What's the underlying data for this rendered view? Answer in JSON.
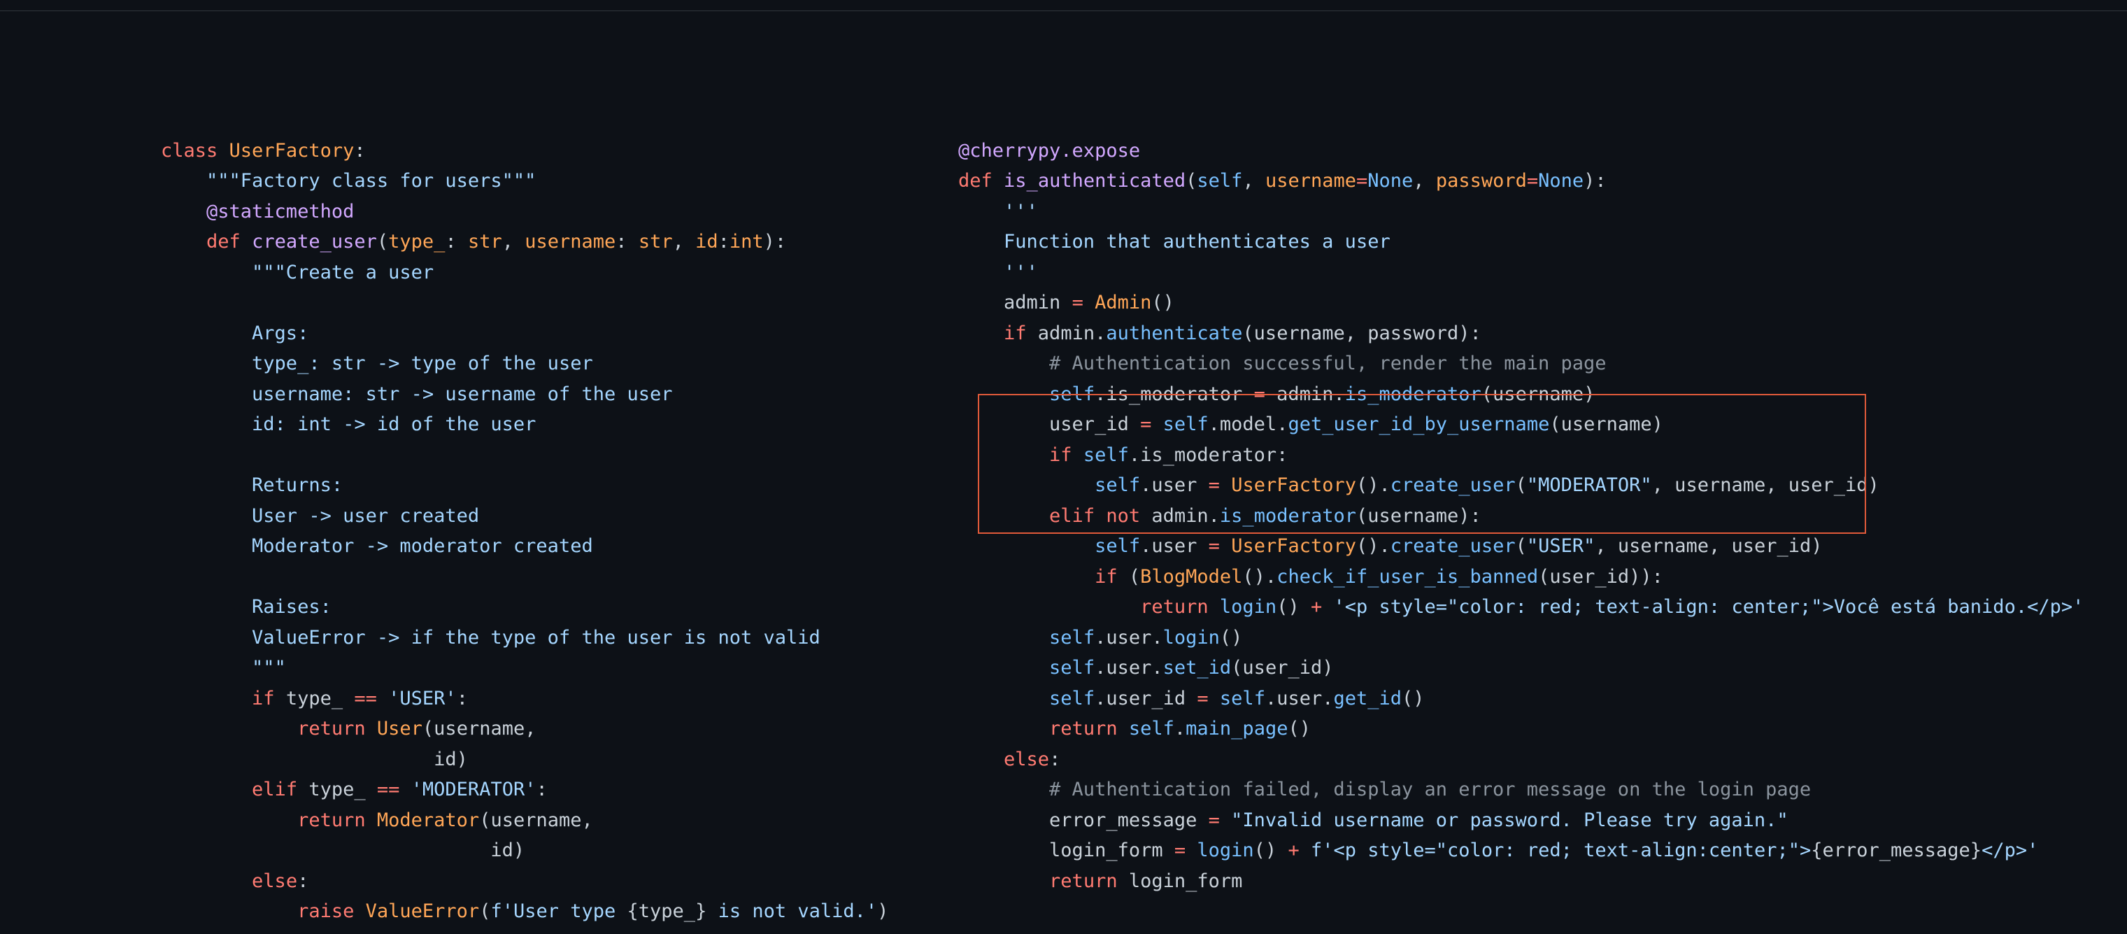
{
  "left": {
    "l01a": "class",
    "l01b": " ",
    "l01c": "UserFactory",
    "l01d": ":",
    "l02": "    \"\"\"Factory class for users\"\"\"",
    "l03": "    @staticmethod",
    "l04a": "    ",
    "l04b": "def",
    "l04c": " ",
    "l04d": "create_user",
    "l04e": "(",
    "l04f": "type_",
    "l04g": ": ",
    "l04h": "str",
    "l04i": ", ",
    "l04j": "username",
    "l04k": ": ",
    "l04l": "str",
    "l04m": ", ",
    "l04n": "id",
    "l04o": ":",
    "l04p": "int",
    "l04q": "):",
    "l05": "        \"\"\"Create a user",
    "l06": "",
    "l07": "        Args:",
    "l08": "        type_: str -> type of the user",
    "l09": "        username: str -> username of the user",
    "l10": "        id: int -> id of the user",
    "l11": "",
    "l12": "        Returns:",
    "l13": "        User -> user created",
    "l14": "        Moderator -> moderator created",
    "l15": "",
    "l16": "        Raises:",
    "l17": "        ValueError -> if the type of the user is not valid",
    "l18": "        \"\"\"",
    "l19a": "        ",
    "l19b": "if",
    "l19c": " type_ ",
    "l19d": "==",
    "l19e": " ",
    "l19f": "'USER'",
    "l19g": ":",
    "l20a": "            ",
    "l20b": "return",
    "l20c": " ",
    "l20d": "User",
    "l20e": "(username,",
    "l21": "                        id)",
    "l22a": "        ",
    "l22b": "elif",
    "l22c": " type_ ",
    "l22d": "==",
    "l22e": " ",
    "l22f": "'MODERATOR'",
    "l22g": ":",
    "l23a": "            ",
    "l23b": "return",
    "l23c": " ",
    "l23d": "Moderator",
    "l23e": "(username,",
    "l24": "                             id)",
    "l25a": "        ",
    "l25b": "else",
    "l25c": ":",
    "l26a": "            ",
    "l26b": "raise",
    "l26c": " ",
    "l26d": "ValueError",
    "l26e": "(",
    "l26f": "f'User type ",
    "l26g": "{type_}",
    "l26h": " is not valid.'",
    "l26i": ")"
  },
  "right": {
    "r01": "@cherrypy.expose",
    "r02a": "def",
    "r02b": " ",
    "r02c": "is_authenticated",
    "r02d": "(",
    "r02e": "self",
    "r02f": ", ",
    "r02g": "username",
    "r02h": "=",
    "r02i": "None",
    "r02j": ", ",
    "r02k": "password",
    "r02l": "=",
    "r02m": "None",
    "r02n": "):",
    "r03": "    '''",
    "r04": "    Function that authenticates a user",
    "r05": "    '''",
    "r06a": "    admin ",
    "r06b": "=",
    "r06c": " ",
    "r06d": "Admin",
    "r06e": "()",
    "r07a": "    ",
    "r07b": "if",
    "r07c": " admin.",
    "r07d": "authenticate",
    "r07e": "(username, password):",
    "r08": "        # Authentication successful, render the main page",
    "r09a": "        ",
    "r09b": "self",
    "r09c": ".is_moderator ",
    "r09d": "=",
    "r09e": " admin.",
    "r09f": "is_moderator",
    "r09g": "(username)",
    "r10a": "        user_id ",
    "r10b": "=",
    "r10c": " ",
    "r10d": "self",
    "r10e": ".model.",
    "r10f": "get_user_id_by_username",
    "r10g": "(username)",
    "r11a": "        ",
    "r11b": "if",
    "r11c": " ",
    "r11d": "self",
    "r11e": ".is_moderator:",
    "r12a": "            ",
    "r12b": "self",
    "r12c": ".user ",
    "r12d": "=",
    "r12e": " ",
    "r12f": "UserFactory",
    "r12g": "().",
    "r12h": "create_user",
    "r12i": "(",
    "r12j": "\"MODERATOR\"",
    "r12k": ", username, user_id)",
    "r13a": "        ",
    "r13b": "elif",
    "r13c": " ",
    "r13d": "not",
    "r13e": " admin.",
    "r13f": "is_moderator",
    "r13g": "(username):",
    "r14a": "            ",
    "r14b": "self",
    "r14c": ".user ",
    "r14d": "=",
    "r14e": " ",
    "r14f": "UserFactory",
    "r14g": "().",
    "r14h": "create_user",
    "r14i": "(",
    "r14j": "\"USER\"",
    "r14k": ", username, user_id)",
    "r15a": "            ",
    "r15b": "if",
    "r15c": " (",
    "r15d": "BlogModel",
    "r15e": "().",
    "r15f": "check_if_user_is_banned",
    "r15g": "(user_id)):",
    "r16a": "                ",
    "r16b": "return",
    "r16c": " ",
    "r16d": "login",
    "r16e": "() ",
    "r16f": "+",
    "r16g": " ",
    "r16h": "'<p style=\"color: red; text-align: center;\">Você está banido.</p>'",
    "r17a": "        ",
    "r17b": "self",
    "r17c": ".user.",
    "r17d": "login",
    "r17e": "()",
    "r18a": "        ",
    "r18b": "self",
    "r18c": ".user.",
    "r18d": "set_id",
    "r18e": "(user_id)",
    "r19a": "        ",
    "r19b": "self",
    "r19c": ".user_id ",
    "r19d": "=",
    "r19e": " ",
    "r19f": "self",
    "r19g": ".user.",
    "r19h": "get_id",
    "r19i": "()",
    "r20a": "        ",
    "r20b": "return",
    "r20c": " ",
    "r20d": "self",
    "r20e": ".",
    "r20f": "main_page",
    "r20g": "()",
    "r21a": "    ",
    "r21b": "else",
    "r21c": ":",
    "r22": "        # Authentication failed, display an error message on the login page",
    "r23a": "        error_message ",
    "r23b": "=",
    "r23c": " ",
    "r23d": "\"Invalid username or password. Please try again.\"",
    "r24a": "        login_form ",
    "r24b": "=",
    "r24c": " ",
    "r24d": "login",
    "r24e": "() ",
    "r24f": "+",
    "r24g": " ",
    "r24h": "f'<p style=\"color: red; text-align:center;\">",
    "r24i": "{error_message}",
    "r24j": "</p>'",
    "r25a": "        ",
    "r25b": "return",
    "r25c": " login_form"
  }
}
